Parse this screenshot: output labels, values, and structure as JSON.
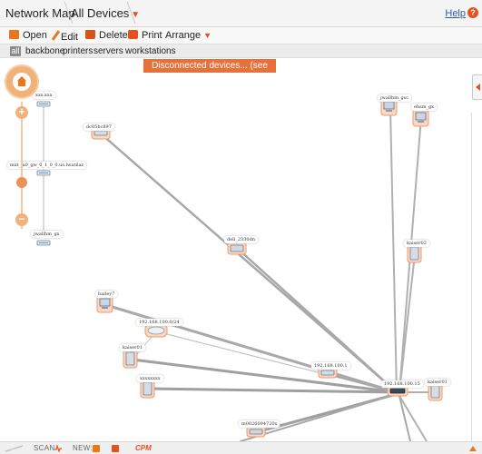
{
  "header": {
    "crumb_root": "Network Map",
    "crumb_current": "All Devices",
    "help_label": "Help",
    "help_glyph": "?"
  },
  "toolbar": {
    "open": "Open",
    "edit": "Edit",
    "delete": "Delete",
    "print": "Print",
    "arrange": "Arrange"
  },
  "filters": {
    "all": "all",
    "items": [
      "backbone",
      "printers",
      "servers",
      "workstations"
    ]
  },
  "banner": "Disconnected devices... (see more)",
  "zoom": {
    "in_glyph": "+",
    "out_glyph": "−"
  },
  "devices": [
    {
      "label": "xxx.xxx",
      "type": "switch"
    },
    {
      "label": "dc05bc897",
      "type": "router"
    },
    {
      "label": "mxt_la0_gw_0_1_0_0.us.lwatilaz",
      "type": "switch"
    },
    {
      "label": "jwallhm_gx",
      "type": "switch"
    },
    {
      "label": "jwallhm_gsc",
      "type": "workstation"
    },
    {
      "label": "ehsm_gx",
      "type": "workstation"
    },
    {
      "label": "dell_2330dn",
      "type": "printer"
    },
    {
      "label": "kaiser02",
      "type": "server"
    },
    {
      "label": "bailey7",
      "type": "workstation"
    },
    {
      "label": "192.168.100.0/24",
      "type": "cloud"
    },
    {
      "label": "kaiser01",
      "type": "server"
    },
    {
      "label": "192.168.100.1",
      "type": "router"
    },
    {
      "label": "xxxxxxxx",
      "type": "server"
    },
    {
      "label": "192.168.100.15",
      "type": "switch"
    },
    {
      "label": "kaiser01",
      "type": "server"
    },
    {
      "label": "m0026094720x",
      "type": "printer"
    }
  ],
  "bottom": {
    "scan": "SCAN",
    "new": "NEW:",
    "brand": "CPM"
  },
  "colors": {
    "accent": "#e8501a",
    "banner": "#e8703a",
    "edge": "#a0a0a0"
  }
}
